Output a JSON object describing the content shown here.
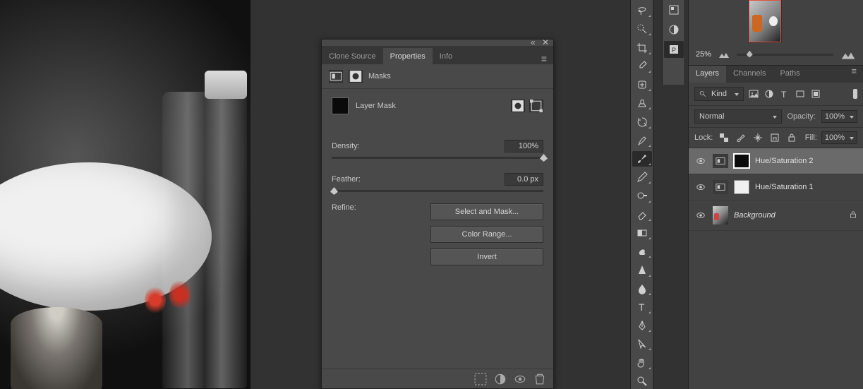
{
  "canvas": {
    "description": "Black and white photo with red color splash: bottle, white shirt, glass"
  },
  "properties_panel": {
    "tabs": {
      "clone_source": "Clone Source",
      "properties": "Properties",
      "info": "Info"
    },
    "header_label": "Masks",
    "mask_kind": "Layer Mask",
    "density": {
      "label": "Density:",
      "value": "100%"
    },
    "feather": {
      "label": "Feather:",
      "value": "0.0 px"
    },
    "refine": {
      "label": "Refine:",
      "select_and_mask": "Select and Mask...",
      "color_range": "Color Range...",
      "invert": "Invert"
    }
  },
  "navigator": {
    "zoom": "25%"
  },
  "layers_panel": {
    "tabs": {
      "layers": "Layers",
      "channels": "Channels",
      "paths": "Paths"
    },
    "kind_label": "Kind",
    "blend_mode": "Normal",
    "opacity_label": "Opacity:",
    "opacity_value": "100%",
    "lock_label": "Lock:",
    "fill_label": "Fill:",
    "fill_value": "100%",
    "layers": [
      {
        "name": "Hue/Saturation 2"
      },
      {
        "name": "Hue/Saturation 1"
      },
      {
        "name": "Background"
      }
    ]
  },
  "icons": {
    "search": "search-icon"
  }
}
